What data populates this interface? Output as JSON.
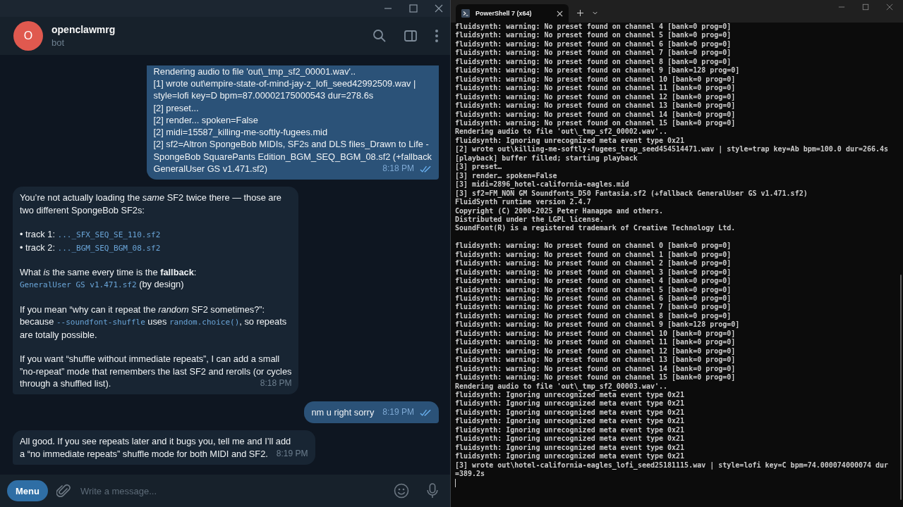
{
  "chat_window": {
    "contact": {
      "initial": "O",
      "name": "openclawmrg",
      "status": "bot"
    },
    "messages": [
      {
        "kind": "outgoing",
        "read": true,
        "time": "8:18 PM",
        "continued": true,
        "paragraphs": [
          [
            [
              {
                "kind": "text",
                "text": "Rendering audio to file 'out\\_tmp_sf2_00001.wav'.."
              }
            ],
            [
              {
                "kind": "text",
                "text": "[1] wrote out\\empire-state-of-mind-jay-z_lofi_seed42992509.wav |"
              }
            ],
            [
              {
                "kind": "text",
                "text": "style=lofi key=D bpm=87.00002175000543 dur=278.6s"
              }
            ],
            [
              {
                "kind": "text",
                "text": "[2] preset..."
              }
            ],
            [
              {
                "kind": "text",
                "text": "[2] render... spoken=False"
              }
            ],
            [
              {
                "kind": "text",
                "text": "[2] midi=15587_killing-me-softly-fugees.mid"
              }
            ],
            [
              {
                "kind": "text",
                "text": "[2] sf2=Altron SpongeBob MIDIs, SF2s and DLS files_Drawn to Life -"
              }
            ],
            [
              {
                "kind": "text",
                "text": "SpongeBob SquarePants Edition_BGM_SEQ_BGM_08.sf2 (+fallback"
              }
            ],
            [
              {
                "kind": "text",
                "text": "GeneralUser GS v1.471.sf2)"
              }
            ]
          ]
        ]
      },
      {
        "kind": "incoming",
        "time": "8:18 PM",
        "paragraphs": [
          [
            [
              {
                "kind": "text",
                "text": "You’re not actually loading the *same* SF2 twice there — those are"
              }
            ],
            [
              {
                "kind": "text",
                "text": "two different SpongeBob SF2s:"
              }
            ]
          ],
          [
            [
              {
                "kind": "text",
                "text": "• track 1: "
              },
              {
                "kind": "code",
                "text": "..._SFX_SEQ_SE_110.sf2"
              }
            ],
            [
              {
                "kind": "text",
                "text": "• track 2: "
              },
              {
                "kind": "code",
                "text": "..._BGM_SEQ_BGM_08.sf2"
              }
            ]
          ],
          [
            [
              {
                "kind": "text",
                "text": "What *is* the same every time is the **fallback**:"
              }
            ],
            [
              {
                "kind": "code",
                "text": "GeneralUser GS v1.471.sf2"
              },
              {
                "kind": "text",
                "text": " (by design)"
              }
            ]
          ],
          [
            [
              {
                "kind": "text",
                "text": "If you mean “why can it repeat the *random* SF2 sometimes?”:"
              }
            ],
            [
              {
                "kind": "text",
                "text": "because "
              },
              {
                "kind": "code",
                "text": "--soundfont-shuffle"
              },
              {
                "kind": "text",
                "text": " uses "
              },
              {
                "kind": "code",
                "text": "random.choice()"
              },
              {
                "kind": "text",
                "text": ", so repeats"
              }
            ],
            [
              {
                "kind": "text",
                "text": "are totally possible."
              }
            ]
          ],
          [
            [
              {
                "kind": "text",
                "text": "If you want “shuffle without immediate repeats”, I can add a small"
              }
            ],
            [
              {
                "kind": "text",
                "text": "”no-repeat” mode that remembers the last SF2 and rerolls (or cycles"
              }
            ],
            [
              {
                "kind": "text",
                "text": "through a shuffled list)."
              }
            ]
          ]
        ]
      },
      {
        "kind": "outgoing",
        "read": true,
        "time": "8:19 PM",
        "continued": false,
        "paragraphs": [
          [
            [
              {
                "kind": "text",
                "text": "nm u right sorry"
              }
            ]
          ]
        ]
      },
      {
        "kind": "incoming",
        "time": "8:19 PM",
        "paragraphs": [
          [
            [
              {
                "kind": "text",
                "text": "All good. If you see repeats later and it bugs you, tell me and I’ll add"
              }
            ],
            [
              {
                "kind": "text",
                "text": "a “no immediate repeats” shuffle mode for both MIDI and SF2."
              }
            ]
          ]
        ]
      }
    ],
    "composer": {
      "menu_button": "Menu",
      "placeholder": "Write a message..."
    }
  },
  "terminal_window": {
    "tab": {
      "title": "PowerShell 7 (x64)",
      "selected": true
    },
    "blocks": [
      [
        "fluidsynth: warning: No preset found on channel 4 [bank=0 prog=0]",
        "fluidsynth: warning: No preset found on channel 5 [bank=0 prog=0]",
        "fluidsynth: warning: No preset found on channel 6 [bank=0 prog=0]",
        "fluidsynth: warning: No preset found on channel 7 [bank=0 prog=0]",
        "fluidsynth: warning: No preset found on channel 8 [bank=0 prog=0]",
        "fluidsynth: warning: No preset found on channel 9 [bank=128 prog=0]",
        "fluidsynth: warning: No preset found on channel 10 [bank=0 prog=0]",
        "fluidsynth: warning: No preset found on channel 11 [bank=0 prog=0]",
        "fluidsynth: warning: No preset found on channel 12 [bank=0 prog=0]",
        "fluidsynth: warning: No preset found on channel 13 [bank=0 prog=0]",
        "fluidsynth: warning: No preset found on channel 14 [bank=0 prog=0]",
        "fluidsynth: warning: No preset found on channel 15 [bank=0 prog=0]",
        "Rendering audio to file 'out\\_tmp_sf2_00002.wav'..",
        "fluidsynth: Ignoring unrecognized meta event type 0x21",
        "[2] wrote out\\killing-me-softly-fugees_trap_seed454514471.wav | style=trap key=Ab bpm=100.0 dur=266.4s",
        "[playback] buffer filled; starting playback",
        "[3] preset…",
        "[3] render… spoken=False",
        "[3] midi=2896_hotel-california-eagles.mid",
        "[3] sf2=FM_NON GM Soundfonts_D50 Fantasia.sf2 (+fallback GeneralUser GS v1.471.sf2)",
        "FluidSynth runtime version 2.4.7",
        "Copyright (C) 2000-2025 Peter Hanappe and others.",
        "Distributed under the LGPL license.",
        "SoundFont(R) is a registered trademark of Creative Technology Ltd."
      ],
      [
        "fluidsynth: warning: No preset found on channel 0 [bank=0 prog=0]",
        "fluidsynth: warning: No preset found on channel 1 [bank=0 prog=0]",
        "fluidsynth: warning: No preset found on channel 2 [bank=0 prog=0]",
        "fluidsynth: warning: No preset found on channel 3 [bank=0 prog=0]",
        "fluidsynth: warning: No preset found on channel 4 [bank=0 prog=0]",
        "fluidsynth: warning: No preset found on channel 5 [bank=0 prog=0]",
        "fluidsynth: warning: No preset found on channel 6 [bank=0 prog=0]",
        "fluidsynth: warning: No preset found on channel 7 [bank=0 prog=0]",
        "fluidsynth: warning: No preset found on channel 8 [bank=0 prog=0]",
        "fluidsynth: warning: No preset found on channel 9 [bank=128 prog=0]",
        "fluidsynth: warning: No preset found on channel 10 [bank=0 prog=0]",
        "fluidsynth: warning: No preset found on channel 11 [bank=0 prog=0]",
        "fluidsynth: warning: No preset found on channel 12 [bank=0 prog=0]",
        "fluidsynth: warning: No preset found on channel 13 [bank=0 prog=0]",
        "fluidsynth: warning: No preset found on channel 14 [bank=0 prog=0]",
        "fluidsynth: warning: No preset found on channel 15 [bank=0 prog=0]",
        "Rendering audio to file 'out\\_tmp_sf2_00003.wav'..",
        "fluidsynth: Ignoring unrecognized meta event type 0x21",
        "fluidsynth: Ignoring unrecognized meta event type 0x21",
        "fluidsynth: Ignoring unrecognized meta event type 0x21",
        "fluidsynth: Ignoring unrecognized meta event type 0x21",
        "fluidsynth: Ignoring unrecognized meta event type 0x21",
        "fluidsynth: Ignoring unrecognized meta event type 0x21",
        "fluidsynth: Ignoring unrecognized meta event type 0x21",
        "fluidsynth: Ignoring unrecognized meta event type 0x21",
        "[3] wrote out\\hotel-california-eagles_lofi_seed25181115.wav | style=lofi key=C bpm=74.000074000074 dur=389.2s"
      ]
    ]
  }
}
